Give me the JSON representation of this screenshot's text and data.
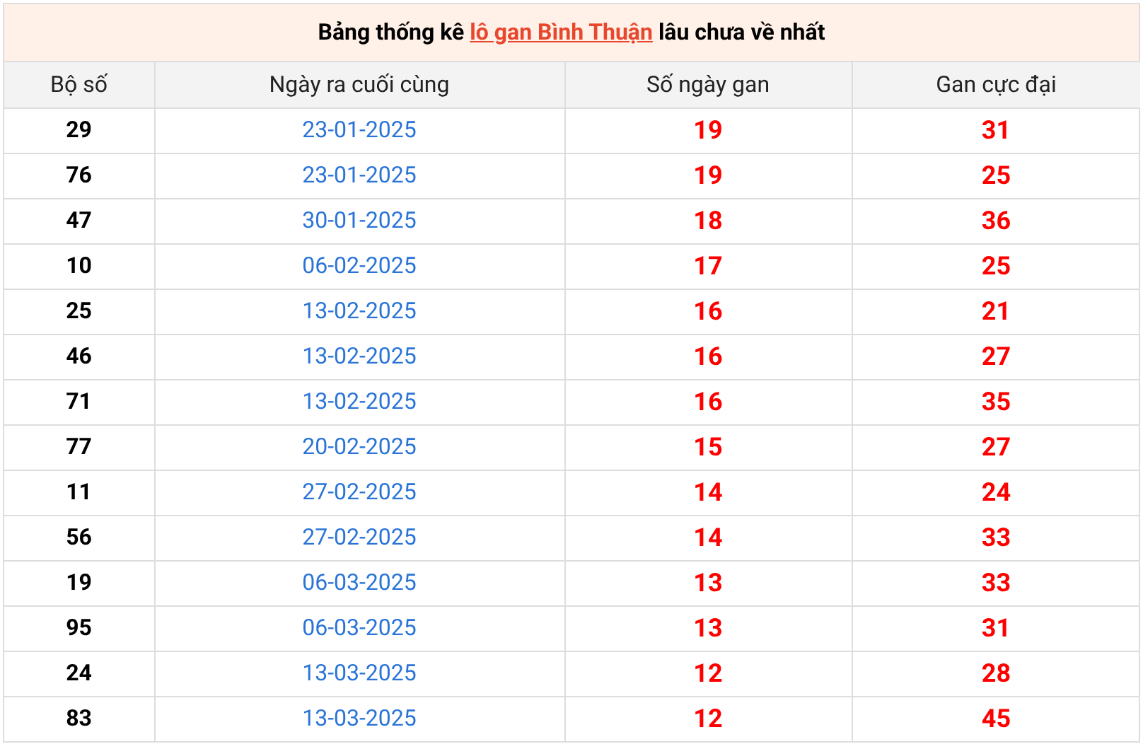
{
  "title": {
    "before": "Bảng thống kê",
    "link": "lô gan Bình Thuận",
    "after": "lâu chưa về nhất"
  },
  "columns": [
    "Bộ số",
    "Ngày ra cuối cùng",
    "Số ngày gan",
    "Gan cực đại"
  ],
  "rows": [
    {
      "number": "29",
      "last_date": "23-01-2025",
      "days": "19",
      "max": "31"
    },
    {
      "number": "76",
      "last_date": "23-01-2025",
      "days": "19",
      "max": "25"
    },
    {
      "number": "47",
      "last_date": "30-01-2025",
      "days": "18",
      "max": "36"
    },
    {
      "number": "10",
      "last_date": "06-02-2025",
      "days": "17",
      "max": "25"
    },
    {
      "number": "25",
      "last_date": "13-02-2025",
      "days": "16",
      "max": "21"
    },
    {
      "number": "46",
      "last_date": "13-02-2025",
      "days": "16",
      "max": "27"
    },
    {
      "number": "71",
      "last_date": "13-02-2025",
      "days": "16",
      "max": "35"
    },
    {
      "number": "77",
      "last_date": "20-02-2025",
      "days": "15",
      "max": "27"
    },
    {
      "number": "11",
      "last_date": "27-02-2025",
      "days": "14",
      "max": "24"
    },
    {
      "number": "56",
      "last_date": "27-02-2025",
      "days": "14",
      "max": "33"
    },
    {
      "number": "19",
      "last_date": "06-03-2025",
      "days": "13",
      "max": "33"
    },
    {
      "number": "95",
      "last_date": "06-03-2025",
      "days": "13",
      "max": "31"
    },
    {
      "number": "24",
      "last_date": "13-03-2025",
      "days": "12",
      "max": "28"
    },
    {
      "number": "83",
      "last_date": "13-03-2025",
      "days": "12",
      "max": "45"
    }
  ]
}
